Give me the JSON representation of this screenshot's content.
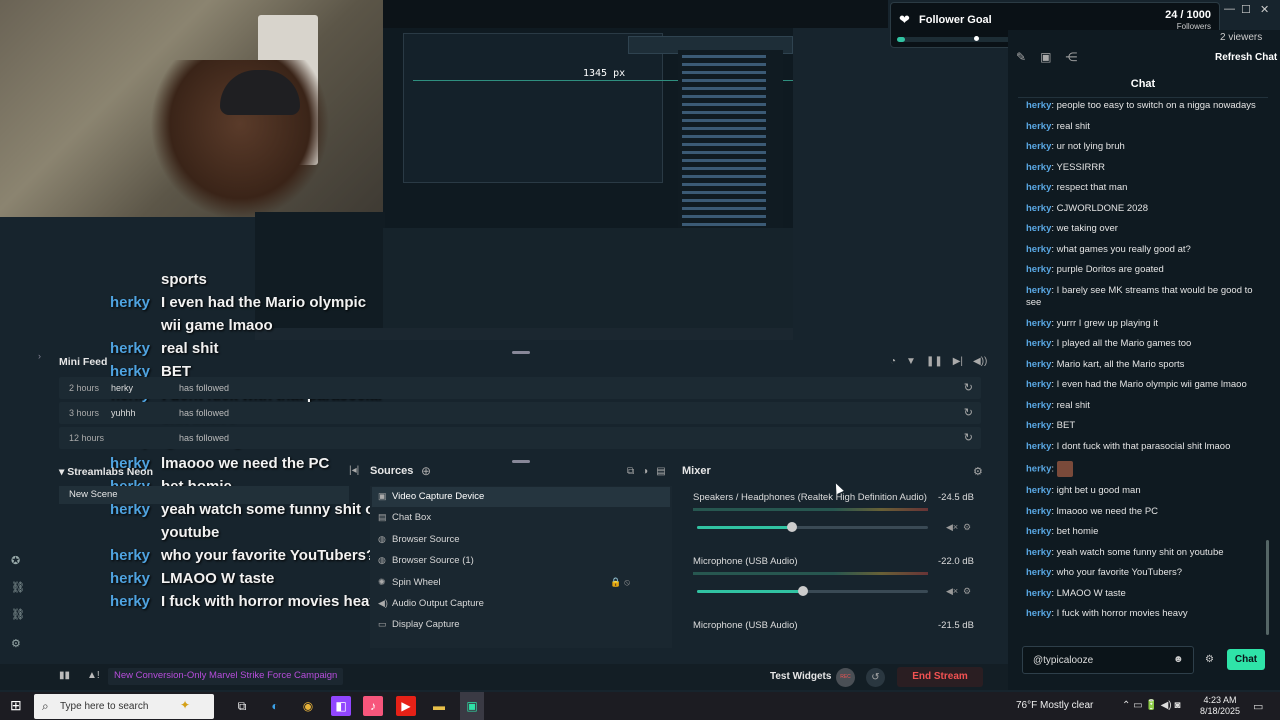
{
  "preview": {
    "measure_label": "1345 px",
    "overlay_chat": {
      "sports_fragment": "sports",
      "lines": [
        {
          "user": "herky",
          "msg": "I even had the Mario olympic wii game lmaoo"
        },
        {
          "user": "herky",
          "msg": "real shit"
        },
        {
          "user": "herky",
          "msg": "BET"
        },
        {
          "user": "herky",
          "msg": "I dont fuck with that parasocial shit lmaoo"
        },
        {
          "user": "herky",
          "msg": "ight bet u good man"
        },
        {
          "user": "herky",
          "msg": "lmaooo we need the PC"
        },
        {
          "user": "herky",
          "msg": "bet homie"
        },
        {
          "user": "herky",
          "msg": "yeah watch some funny shit on youtube"
        },
        {
          "user": "herky",
          "msg": "who your favorite YouTubers?"
        },
        {
          "user": "herky",
          "msg": "LMAOO W taste"
        },
        {
          "user": "herky",
          "msg": "I fuck with horror movies heavy"
        }
      ]
    }
  },
  "follower_goal": {
    "title": "Follower Goal",
    "count": "24 / 1000",
    "subtitle": "Followers",
    "progress_fraction": 0.024,
    "icon": "heart-hands-icon"
  },
  "chat": {
    "viewers": "2 viewers",
    "refresh_label": "Refresh Chat",
    "title": "Chat",
    "messages": [
      {
        "user": "herky",
        "msg": "people too easy to switch on a nigga nowadays"
      },
      {
        "user": "herky",
        "msg": "real shit"
      },
      {
        "user": "herky",
        "msg": "ur not lying bruh"
      },
      {
        "user": "herky",
        "msg": "YESSIRRR"
      },
      {
        "user": "herky",
        "msg": "respect that man"
      },
      {
        "user": "herky",
        "msg": "CJWORLDONE 2028"
      },
      {
        "user": "herky",
        "msg": "we taking over"
      },
      {
        "user": "herky",
        "msg": "what games you really good at?"
      },
      {
        "user": "herky",
        "msg": "purple Doritos are goated"
      },
      {
        "user": "herky",
        "msg": "I barely see MK streams that would be good to see"
      },
      {
        "user": "herky",
        "msg": "yurrr I grew up playing it"
      },
      {
        "user": "herky",
        "msg": "I played all the Mario games too"
      },
      {
        "user": "herky",
        "msg": "Mario kart, all the Mario sports"
      },
      {
        "user": "herky",
        "msg": "I even had the Mario olympic wii game lmaoo"
      },
      {
        "user": "herky",
        "msg": "real shit"
      },
      {
        "user": "herky",
        "msg": "BET"
      },
      {
        "user": "herky",
        "msg": "I dont fuck with that parasocial shit lmaoo"
      },
      {
        "user": "herky",
        "msg": ""
      },
      {
        "user": "herky",
        "msg": "ight bet u good man"
      },
      {
        "user": "herky",
        "msg": "lmaooo we need the PC"
      },
      {
        "user": "herky",
        "msg": "bet homie"
      },
      {
        "user": "herky",
        "msg": "yeah watch some funny shit on youtube"
      },
      {
        "user": "herky",
        "msg": "who your favorite YouTubers?"
      },
      {
        "user": "herky",
        "msg": "LMAOO W taste"
      },
      {
        "user": "herky",
        "msg": "I fuck with horror movies heavy"
      }
    ],
    "input_value": "@typicalooze",
    "send_label": "Chat"
  },
  "mini_feed": {
    "title": "Mini Feed",
    "rows": [
      {
        "time": "2 hours",
        "who": "herky",
        "action": "has followed"
      },
      {
        "time": "3 hours",
        "who": "yuhhh",
        "action": "has followed"
      },
      {
        "time": "12 hours",
        "who": "",
        "action": "has followed"
      }
    ]
  },
  "scenes": {
    "title": "Streamlabs Neon",
    "items": [
      "New Scene"
    ]
  },
  "sources": {
    "title": "Sources",
    "items": [
      {
        "label": "Video Capture Device",
        "icon": "camera-icon",
        "selected": true
      },
      {
        "label": "Chat Box",
        "icon": "chat-icon",
        "selected": false
      },
      {
        "label": "Browser Source",
        "icon": "globe-icon",
        "selected": false
      },
      {
        "label": "Browser Source (1)",
        "icon": "globe-icon",
        "selected": false
      },
      {
        "label": "Spin Wheel",
        "icon": "wheel-icon",
        "selected": false
      },
      {
        "label": "Audio Output Capture",
        "icon": "speaker-icon",
        "selected": false
      },
      {
        "label": "Display Capture",
        "icon": "monitor-icon",
        "selected": false
      }
    ]
  },
  "mixer": {
    "title": "Mixer",
    "channels": [
      {
        "name": "Speakers / Headphones (Realtek High Definition Audio)",
        "db": "-24.5 dB",
        "level": 0.41
      },
      {
        "name": "Microphone (USB Audio)",
        "db": "-22.0 dB",
        "level": 0.46
      },
      {
        "name": "Microphone (USB Audio)",
        "db": "-21.5 dB",
        "level": 0.47
      }
    ]
  },
  "bottom_bar": {
    "promo": "New Conversion-Only Marvel Strike Force Campaign",
    "test_widgets": "Test Widgets",
    "rec_label": "REC",
    "end_stream": "End Stream"
  },
  "taskbar": {
    "search_placeholder": "Type here to search",
    "weather": "76°F  Mostly clear",
    "time": "4:23 AM",
    "date": "8/18/2025"
  }
}
